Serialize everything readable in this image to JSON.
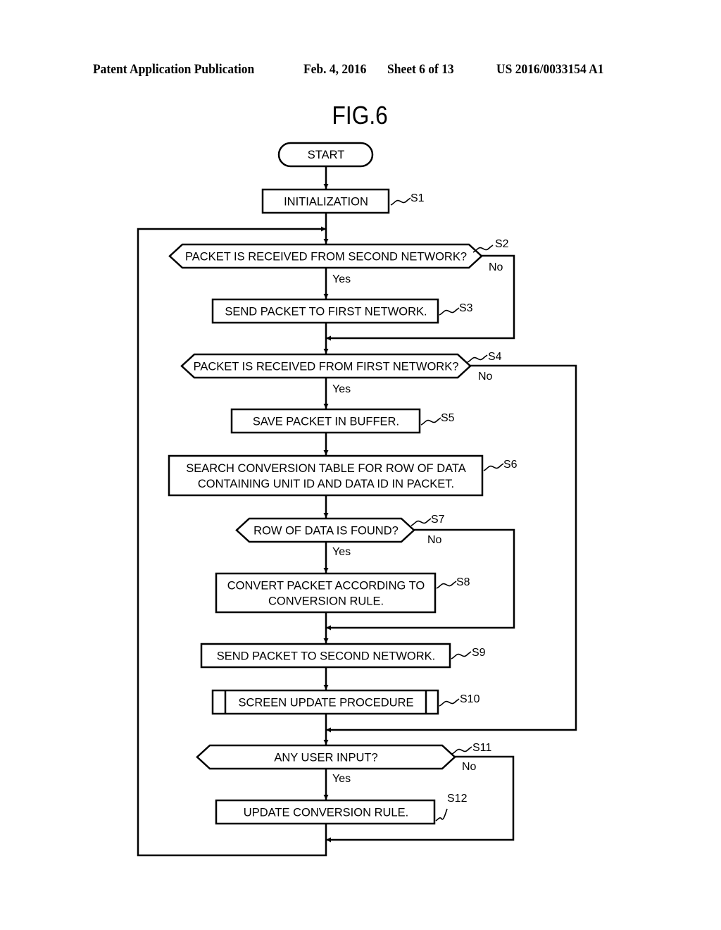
{
  "header": {
    "publication": "Patent Application Publication",
    "date": "Feb. 4, 2016",
    "sheet": "Sheet 6 of 13",
    "number": "US 2016/0033154 A1"
  },
  "figure": {
    "title": "FIG.6"
  },
  "flowchart": {
    "start": "START",
    "steps": {
      "s1": {
        "id": "S1",
        "text": [
          "INITIALIZATION"
        ]
      },
      "s2": {
        "id": "S2",
        "text": [
          "PACKET IS RECEIVED FROM SECOND NETWORK?"
        ],
        "yes": "Yes",
        "no": "No"
      },
      "s3": {
        "id": "S3",
        "text": [
          "SEND PACKET TO FIRST NETWORK."
        ]
      },
      "s4": {
        "id": "S4",
        "text": [
          "PACKET IS RECEIVED FROM FIRST NETWORK?"
        ],
        "yes": "Yes",
        "no": "No"
      },
      "s5": {
        "id": "S5",
        "text": [
          "SAVE PACKET IN BUFFER."
        ]
      },
      "s6": {
        "id": "S6",
        "text": [
          "SEARCH CONVERSION TABLE FOR ROW OF DATA",
          "CONTAINING UNIT ID AND DATA ID IN PACKET."
        ]
      },
      "s7": {
        "id": "S7",
        "text": [
          "ROW OF DATA IS FOUND?"
        ],
        "yes": "Yes",
        "no": "No"
      },
      "s8": {
        "id": "S8",
        "text": [
          "CONVERT PACKET ACCORDING TO",
          "CONVERSION RULE."
        ]
      },
      "s9": {
        "id": "S9",
        "text": [
          "SEND PACKET TO SECOND NETWORK."
        ]
      },
      "s10": {
        "id": "S10",
        "text": [
          "SCREEN UPDATE PROCEDURE"
        ]
      },
      "s11": {
        "id": "S11",
        "text": [
          "ANY USER INPUT?"
        ],
        "yes": "Yes",
        "no": "No"
      },
      "s12": {
        "id": "S12",
        "text": [
          "UPDATE CONVERSION RULE."
        ]
      }
    }
  }
}
